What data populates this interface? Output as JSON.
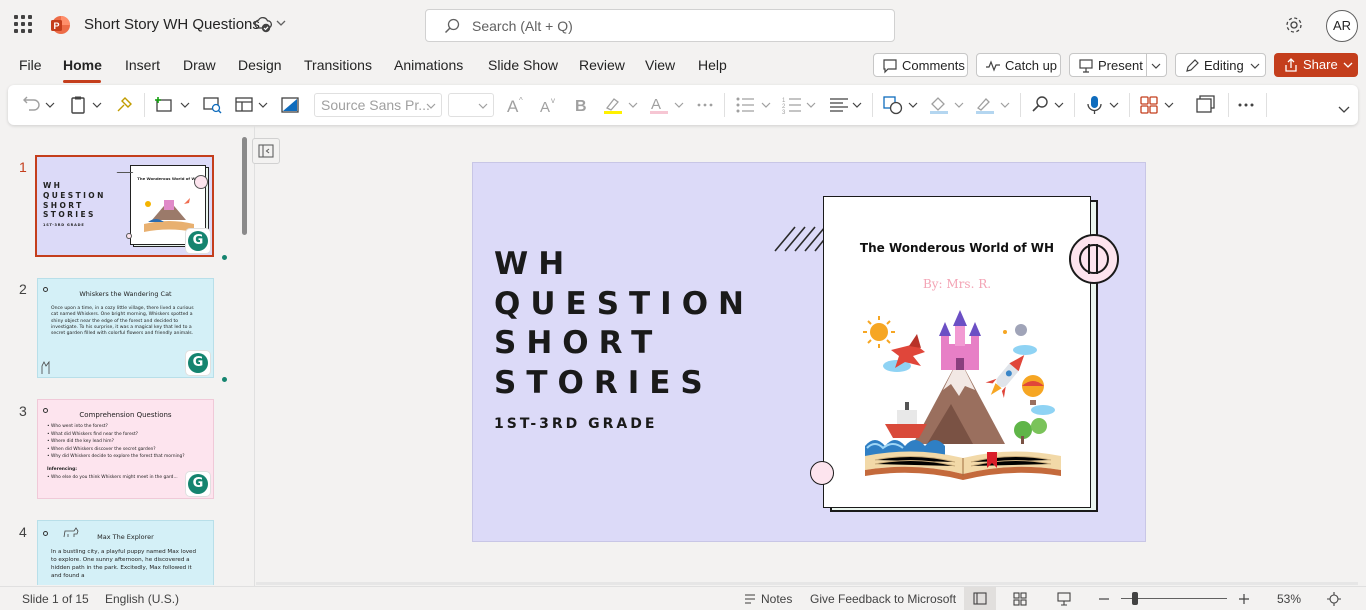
{
  "app": {
    "title": "Short Story WH Questions",
    "search_placeholder": "Search (Alt + Q)",
    "user_initials": "AR"
  },
  "menu": {
    "tabs": [
      "File",
      "Home",
      "Insert",
      "Draw",
      "Design",
      "Transitions",
      "Animations",
      "Slide Show",
      "Review",
      "View",
      "Help"
    ],
    "active_tab": "Home",
    "comments": "Comments",
    "catch_up": "Catch up",
    "present": "Present",
    "editing": "Editing",
    "share": "Share"
  },
  "ribbon": {
    "font_name": "Source Sans Pr...",
    "font_size": ""
  },
  "thumbnails": [
    {
      "number": "1",
      "title": "WH QUESTION SHORT STORIES",
      "subtitle": "1ST-3RD GRADE",
      "inner_title": "The Wonderous World of WH"
    },
    {
      "number": "2",
      "title": "Whiskers the Wandering Cat",
      "text": "Once upon a time, in a cozy little village, there lived a curious cat named Whiskers. One bright morning, Whiskers spotted a shiny object near the edge of the forest and decided to investigate. To his surprise, it was a magical key that led to a secret garden filled with colorful flowers and friendly animals."
    },
    {
      "number": "3",
      "title": "Comprehension Questions",
      "bullets": [
        "Who went into the forest?",
        "What did Whiskers find near the forest?",
        "Where did the key lead him?",
        "When did Whiskers discover the secret garden?",
        "Why did Whiskers decide to explore the forest that morning?"
      ],
      "sub_heading": "Inferencing:",
      "sub_bullets": [
        "Who else do you think Whiskers might meet in the gard..."
      ]
    },
    {
      "number": "4",
      "title": "Max The Explorer",
      "text": "In a bustling city, a playful puppy named Max loved to explore. One sunny afternoon, he discovered a hidden path in the park. Excitedly, Max followed it and found a"
    }
  ],
  "slide": {
    "title_lines": [
      "WH",
      "QUESTION",
      "SHORT",
      "STORIES"
    ],
    "subtitle": "1ST-3RD GRADE",
    "inner_title": "The Wonderous World of WH",
    "author": "By: Mrs. R.",
    "background": "#dcdaf8"
  },
  "status": {
    "slide_info": "Slide 1 of 15",
    "language": "English (U.S.)",
    "notes": "Notes",
    "feedback": "Give Feedback to Microsoft",
    "zoom": "53%"
  },
  "colors": {
    "accent": "#c43e1c",
    "slide_bg": "#dcdaf8",
    "thumb_blue": "#d4f0f7",
    "thumb_pink": "#fde4ee",
    "grammarly": "#15846f"
  }
}
